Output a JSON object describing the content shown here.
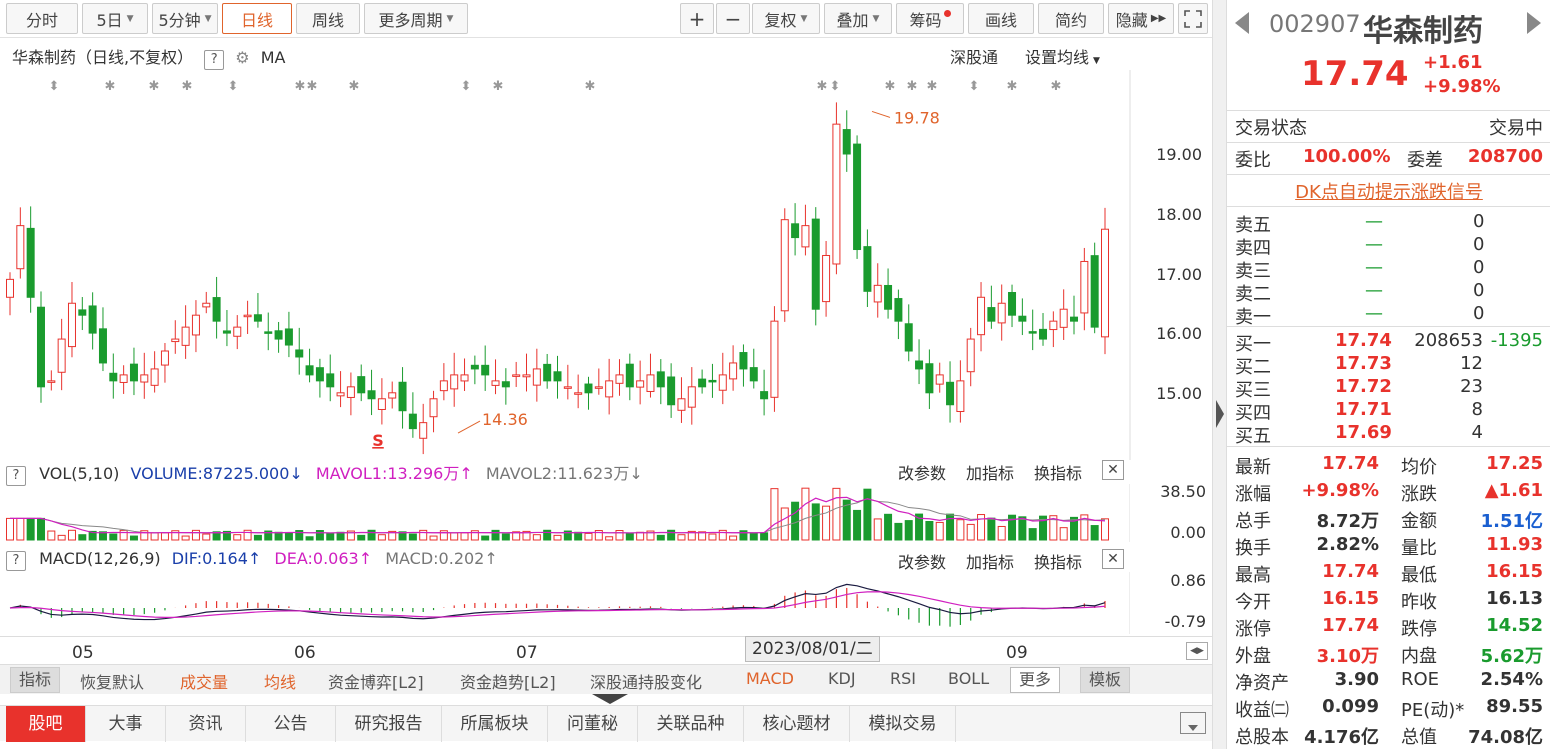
{
  "toolbar": {
    "periods": [
      "分时",
      "5日",
      "5分钟",
      "日线",
      "周线",
      "更多周期"
    ],
    "right_buttons": [
      "+",
      "−",
      "复权",
      "叠加",
      "筹码",
      "画线",
      "简约",
      "隐藏"
    ]
  },
  "chart": {
    "title": "华森制药（日线,不复权）",
    "ma_label": "MA",
    "links": [
      "深股通",
      "设置均线"
    ],
    "price_axis": [
      "19.00",
      "18.00",
      "17.00",
      "16.00",
      "15.00"
    ],
    "high_label": "19.78",
    "low_label": "14.36",
    "s_marker": "S"
  },
  "vol_panel": {
    "name": "VOL(5,10)",
    "volume": "VOLUME:87225.000",
    "mavol1": "MAVOL1:13.296万",
    "mavol2": "MAVOL2:11.623万",
    "axis": [
      "38.50",
      "0.00"
    ],
    "tools": [
      "改参数",
      "加指标",
      "换指标"
    ]
  },
  "macd_panel": {
    "name": "MACD(12,26,9)",
    "dif": "DIF:0.164",
    "dea": "DEA:0.063",
    "macd": "MACD:0.202",
    "axis": [
      "0.86",
      "-0.79"
    ],
    "tools": [
      "改参数",
      "加指标",
      "换指标"
    ]
  },
  "x_axis": [
    "05",
    "06",
    "07",
    "09"
  ],
  "date_tip": "2023/08/01/二",
  "indicator_bar": [
    "指标",
    "恢复默认",
    "成交量",
    "均线",
    "资金博弈[L2]",
    "资金趋势[L2]",
    "深股通持股变化",
    "MACD",
    "KDJ",
    "RSI",
    "BOLL",
    "更多",
    "模板"
  ],
  "tabs": [
    "股吧",
    "大事",
    "资讯",
    "公告",
    "研究报告",
    "所属板块",
    "问董秘",
    "关联品种",
    "核心题材",
    "模拟交易"
  ],
  "quote": {
    "code": "002907",
    "name": "华森制药",
    "price": "17.74",
    "change": "+1.61",
    "pct": "+9.98%",
    "status_label": "交易状态",
    "status": "交易中",
    "weibi_label": "委比",
    "weibi": "100.00%",
    "weicha_label": "委差",
    "weicha": "208700",
    "dk_signal": "DK点自动提示涨跌信号",
    "asks": [
      {
        "label": "卖五",
        "price": "—",
        "vol": "0"
      },
      {
        "label": "卖四",
        "price": "—",
        "vol": "0"
      },
      {
        "label": "卖三",
        "price": "—",
        "vol": "0"
      },
      {
        "label": "卖二",
        "price": "—",
        "vol": "0"
      },
      {
        "label": "卖一",
        "price": "—",
        "vol": "0"
      }
    ],
    "bids": [
      {
        "label": "买一",
        "price": "17.74",
        "vol": "208653",
        "chg": "-1395"
      },
      {
        "label": "买二",
        "price": "17.73",
        "vol": "12",
        "chg": ""
      },
      {
        "label": "买三",
        "price": "17.72",
        "vol": "23",
        "chg": ""
      },
      {
        "label": "买四",
        "price": "17.71",
        "vol": "8",
        "chg": ""
      },
      {
        "label": "买五",
        "price": "17.69",
        "vol": "4",
        "chg": ""
      }
    ],
    "stats": [
      [
        {
          "l": "最新",
          "v": "17.74",
          "c": "red"
        },
        {
          "l": "均价",
          "v": "17.25",
          "c": "red"
        }
      ],
      [
        {
          "l": "涨幅",
          "v": "+9.98%",
          "c": "red"
        },
        {
          "l": "涨跌",
          "v": "▲1.61",
          "c": "red"
        }
      ],
      [
        {
          "l": "总手",
          "v": "8.72万",
          "c": ""
        },
        {
          "l": "金额",
          "v": "1.51亿",
          "c": "blue"
        }
      ],
      [
        {
          "l": "换手",
          "v": "2.82%",
          "c": ""
        },
        {
          "l": "量比",
          "v": "11.93",
          "c": "red"
        }
      ],
      [
        {
          "l": "最高",
          "v": "17.74",
          "c": "red"
        },
        {
          "l": "最低",
          "v": "16.15",
          "c": "red"
        }
      ],
      [
        {
          "l": "今开",
          "v": "16.15",
          "c": "red"
        },
        {
          "l": "昨收",
          "v": "16.13",
          "c": ""
        }
      ],
      [
        {
          "l": "涨停",
          "v": "17.74",
          "c": "red"
        },
        {
          "l": "跌停",
          "v": "14.52",
          "c": "green"
        }
      ],
      [
        {
          "l": "外盘",
          "v": "3.10万",
          "c": "red"
        },
        {
          "l": "内盘",
          "v": "5.62万",
          "c": "green"
        }
      ],
      [
        {
          "l": "净资产",
          "v": "3.90",
          "c": ""
        },
        {
          "l": "ROE",
          "v": "2.54%",
          "c": ""
        }
      ],
      [
        {
          "l": "收益㈡",
          "v": "0.099",
          "c": ""
        },
        {
          "l": "PE(动)*",
          "v": "89.55",
          "c": ""
        }
      ],
      [
        {
          "l": "总股本",
          "v": "4.176亿",
          "c": ""
        },
        {
          "l": "总值",
          "v": "74.08亿",
          "c": ""
        }
      ]
    ]
  },
  "colors": {
    "up": "#e8322c",
    "down": "#1a9b2e",
    "accent": "#e0642c"
  }
}
